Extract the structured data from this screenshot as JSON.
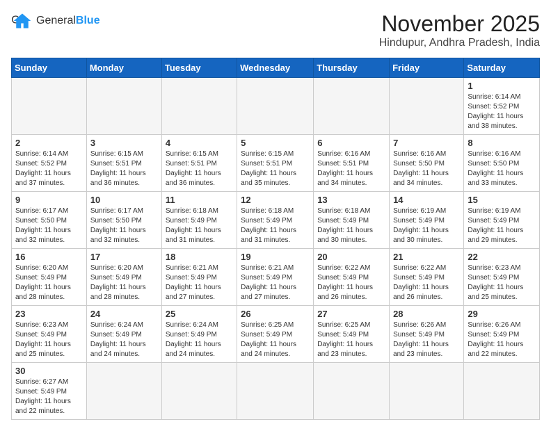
{
  "header": {
    "logo_general": "General",
    "logo_blue": "Blue",
    "month_title": "November 2025",
    "location": "Hindupur, Andhra Pradesh, India"
  },
  "weekdays": [
    "Sunday",
    "Monday",
    "Tuesday",
    "Wednesday",
    "Thursday",
    "Friday",
    "Saturday"
  ],
  "weeks": [
    [
      {
        "day": "",
        "info": ""
      },
      {
        "day": "",
        "info": ""
      },
      {
        "day": "",
        "info": ""
      },
      {
        "day": "",
        "info": ""
      },
      {
        "day": "",
        "info": ""
      },
      {
        "day": "",
        "info": ""
      },
      {
        "day": "1",
        "info": "Sunrise: 6:14 AM\nSunset: 5:52 PM\nDaylight: 11 hours\nand 38 minutes."
      }
    ],
    [
      {
        "day": "2",
        "info": "Sunrise: 6:14 AM\nSunset: 5:52 PM\nDaylight: 11 hours\nand 37 minutes."
      },
      {
        "day": "3",
        "info": "Sunrise: 6:15 AM\nSunset: 5:51 PM\nDaylight: 11 hours\nand 36 minutes."
      },
      {
        "day": "4",
        "info": "Sunrise: 6:15 AM\nSunset: 5:51 PM\nDaylight: 11 hours\nand 36 minutes."
      },
      {
        "day": "5",
        "info": "Sunrise: 6:15 AM\nSunset: 5:51 PM\nDaylight: 11 hours\nand 35 minutes."
      },
      {
        "day": "6",
        "info": "Sunrise: 6:16 AM\nSunset: 5:51 PM\nDaylight: 11 hours\nand 34 minutes."
      },
      {
        "day": "7",
        "info": "Sunrise: 6:16 AM\nSunset: 5:50 PM\nDaylight: 11 hours\nand 34 minutes."
      },
      {
        "day": "8",
        "info": "Sunrise: 6:16 AM\nSunset: 5:50 PM\nDaylight: 11 hours\nand 33 minutes."
      }
    ],
    [
      {
        "day": "9",
        "info": "Sunrise: 6:17 AM\nSunset: 5:50 PM\nDaylight: 11 hours\nand 32 minutes."
      },
      {
        "day": "10",
        "info": "Sunrise: 6:17 AM\nSunset: 5:50 PM\nDaylight: 11 hours\nand 32 minutes."
      },
      {
        "day": "11",
        "info": "Sunrise: 6:18 AM\nSunset: 5:49 PM\nDaylight: 11 hours\nand 31 minutes."
      },
      {
        "day": "12",
        "info": "Sunrise: 6:18 AM\nSunset: 5:49 PM\nDaylight: 11 hours\nand 31 minutes."
      },
      {
        "day": "13",
        "info": "Sunrise: 6:18 AM\nSunset: 5:49 PM\nDaylight: 11 hours\nand 30 minutes."
      },
      {
        "day": "14",
        "info": "Sunrise: 6:19 AM\nSunset: 5:49 PM\nDaylight: 11 hours\nand 30 minutes."
      },
      {
        "day": "15",
        "info": "Sunrise: 6:19 AM\nSunset: 5:49 PM\nDaylight: 11 hours\nand 29 minutes."
      }
    ],
    [
      {
        "day": "16",
        "info": "Sunrise: 6:20 AM\nSunset: 5:49 PM\nDaylight: 11 hours\nand 28 minutes."
      },
      {
        "day": "17",
        "info": "Sunrise: 6:20 AM\nSunset: 5:49 PM\nDaylight: 11 hours\nand 28 minutes."
      },
      {
        "day": "18",
        "info": "Sunrise: 6:21 AM\nSunset: 5:49 PM\nDaylight: 11 hours\nand 27 minutes."
      },
      {
        "day": "19",
        "info": "Sunrise: 6:21 AM\nSunset: 5:49 PM\nDaylight: 11 hours\nand 27 minutes."
      },
      {
        "day": "20",
        "info": "Sunrise: 6:22 AM\nSunset: 5:49 PM\nDaylight: 11 hours\nand 26 minutes."
      },
      {
        "day": "21",
        "info": "Sunrise: 6:22 AM\nSunset: 5:49 PM\nDaylight: 11 hours\nand 26 minutes."
      },
      {
        "day": "22",
        "info": "Sunrise: 6:23 AM\nSunset: 5:49 PM\nDaylight: 11 hours\nand 25 minutes."
      }
    ],
    [
      {
        "day": "23",
        "info": "Sunrise: 6:23 AM\nSunset: 5:49 PM\nDaylight: 11 hours\nand 25 minutes."
      },
      {
        "day": "24",
        "info": "Sunrise: 6:24 AM\nSunset: 5:49 PM\nDaylight: 11 hours\nand 24 minutes."
      },
      {
        "day": "25",
        "info": "Sunrise: 6:24 AM\nSunset: 5:49 PM\nDaylight: 11 hours\nand 24 minutes."
      },
      {
        "day": "26",
        "info": "Sunrise: 6:25 AM\nSunset: 5:49 PM\nDaylight: 11 hours\nand 24 minutes."
      },
      {
        "day": "27",
        "info": "Sunrise: 6:25 AM\nSunset: 5:49 PM\nDaylight: 11 hours\nand 23 minutes."
      },
      {
        "day": "28",
        "info": "Sunrise: 6:26 AM\nSunset: 5:49 PM\nDaylight: 11 hours\nand 23 minutes."
      },
      {
        "day": "29",
        "info": "Sunrise: 6:26 AM\nSunset: 5:49 PM\nDaylight: 11 hours\nand 22 minutes."
      }
    ],
    [
      {
        "day": "30",
        "info": "Sunrise: 6:27 AM\nSunset: 5:49 PM\nDaylight: 11 hours\nand 22 minutes."
      },
      {
        "day": "",
        "info": ""
      },
      {
        "day": "",
        "info": ""
      },
      {
        "day": "",
        "info": ""
      },
      {
        "day": "",
        "info": ""
      },
      {
        "day": "",
        "info": ""
      },
      {
        "day": "",
        "info": ""
      }
    ]
  ]
}
